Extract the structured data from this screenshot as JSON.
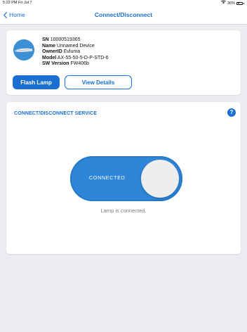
{
  "status_bar": {
    "time": "5:22 PM  Fri Jul 7",
    "battery": "36%",
    "battery_level": 0.36,
    "icons": [
      "wifi-icon",
      "battery-icon"
    ]
  },
  "nav": {
    "back_label": "Home",
    "title": "Connect/Disconnect",
    "back_icon": "chevron-left-icon"
  },
  "device": {
    "image_icon": "lamp-device-icon",
    "fields": [
      {
        "label": "SN",
        "value": "10000519365"
      },
      {
        "label": "Name",
        "value": "Unnamed Device"
      },
      {
        "label": "OwnerID",
        "value": "Evluma"
      },
      {
        "label": "Model",
        "value": "AX-55-50-5-D-P-STD-6"
      },
      {
        "label": "SW Version",
        "value": "FW406b"
      }
    ],
    "flash_label": "Flash Lamp",
    "details_label": "View Details"
  },
  "service": {
    "title": "CONNECT/DISCONNECT SERVICE",
    "help_label": "?",
    "toggle_label": "CONNECTED",
    "toggle_on": true,
    "status_text": "Lamp is connected."
  },
  "colors": {
    "accent": "#1a6fd1",
    "toggle": "#2f86d8",
    "background": "#ececf0"
  }
}
